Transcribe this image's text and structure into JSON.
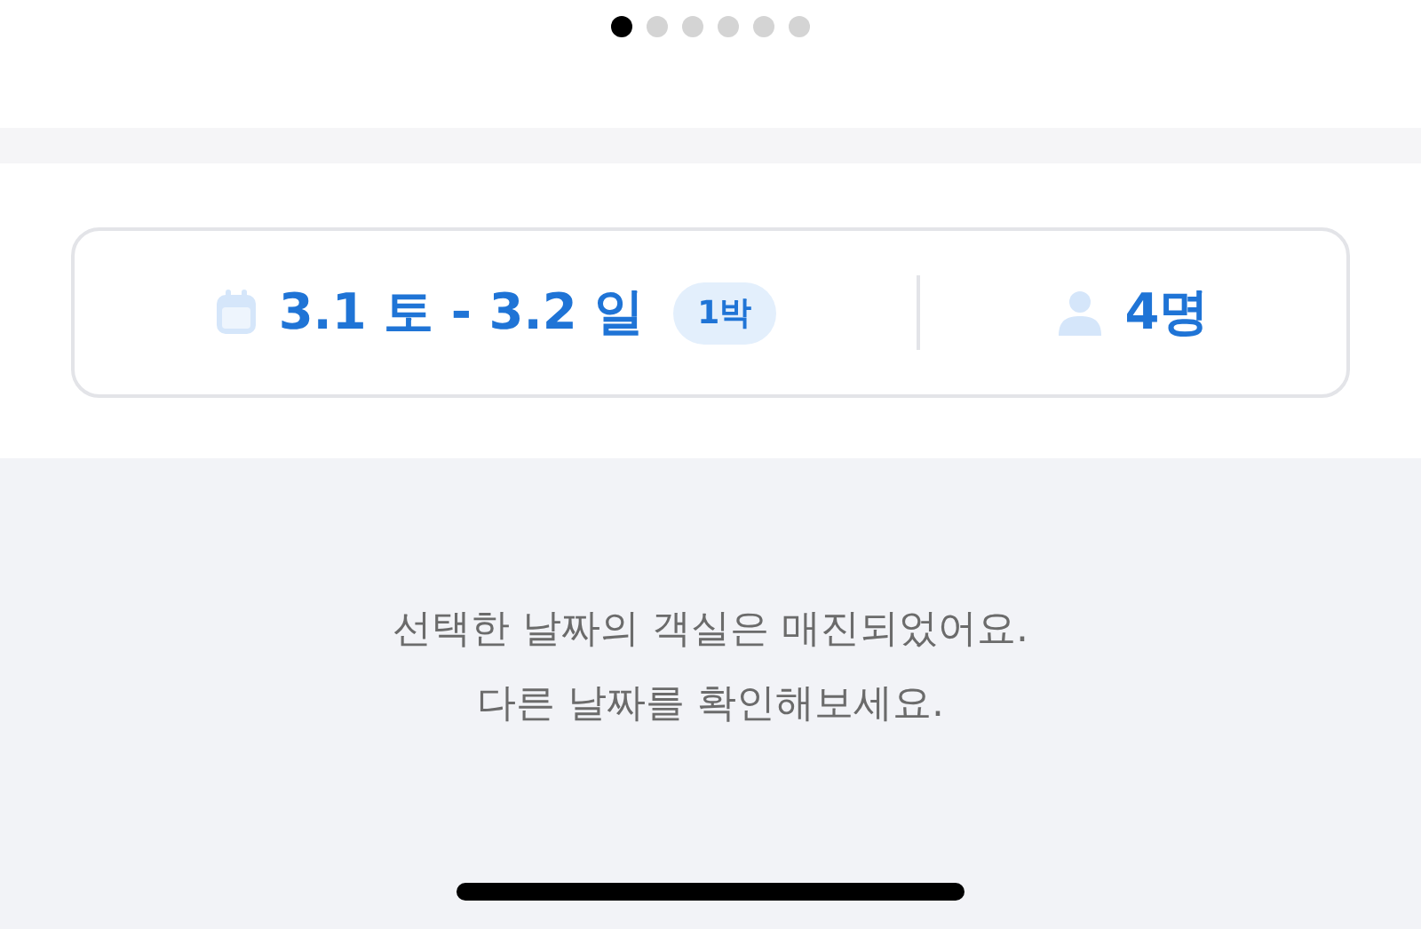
{
  "carousel_dots": [
    {
      "selected": true
    },
    {
      "selected": false
    },
    {
      "selected": false
    },
    {
      "selected": false
    },
    {
      "selected": false
    },
    {
      "selected": false
    }
  ],
  "booking": {
    "dates": "3.1 토 - 3.2 일",
    "nights": "1박",
    "guests": "4명"
  },
  "message": [
    "선택한 날짜의 객실은 매진되었어요.",
    "다른 날짜를 확인해보세요."
  ]
}
